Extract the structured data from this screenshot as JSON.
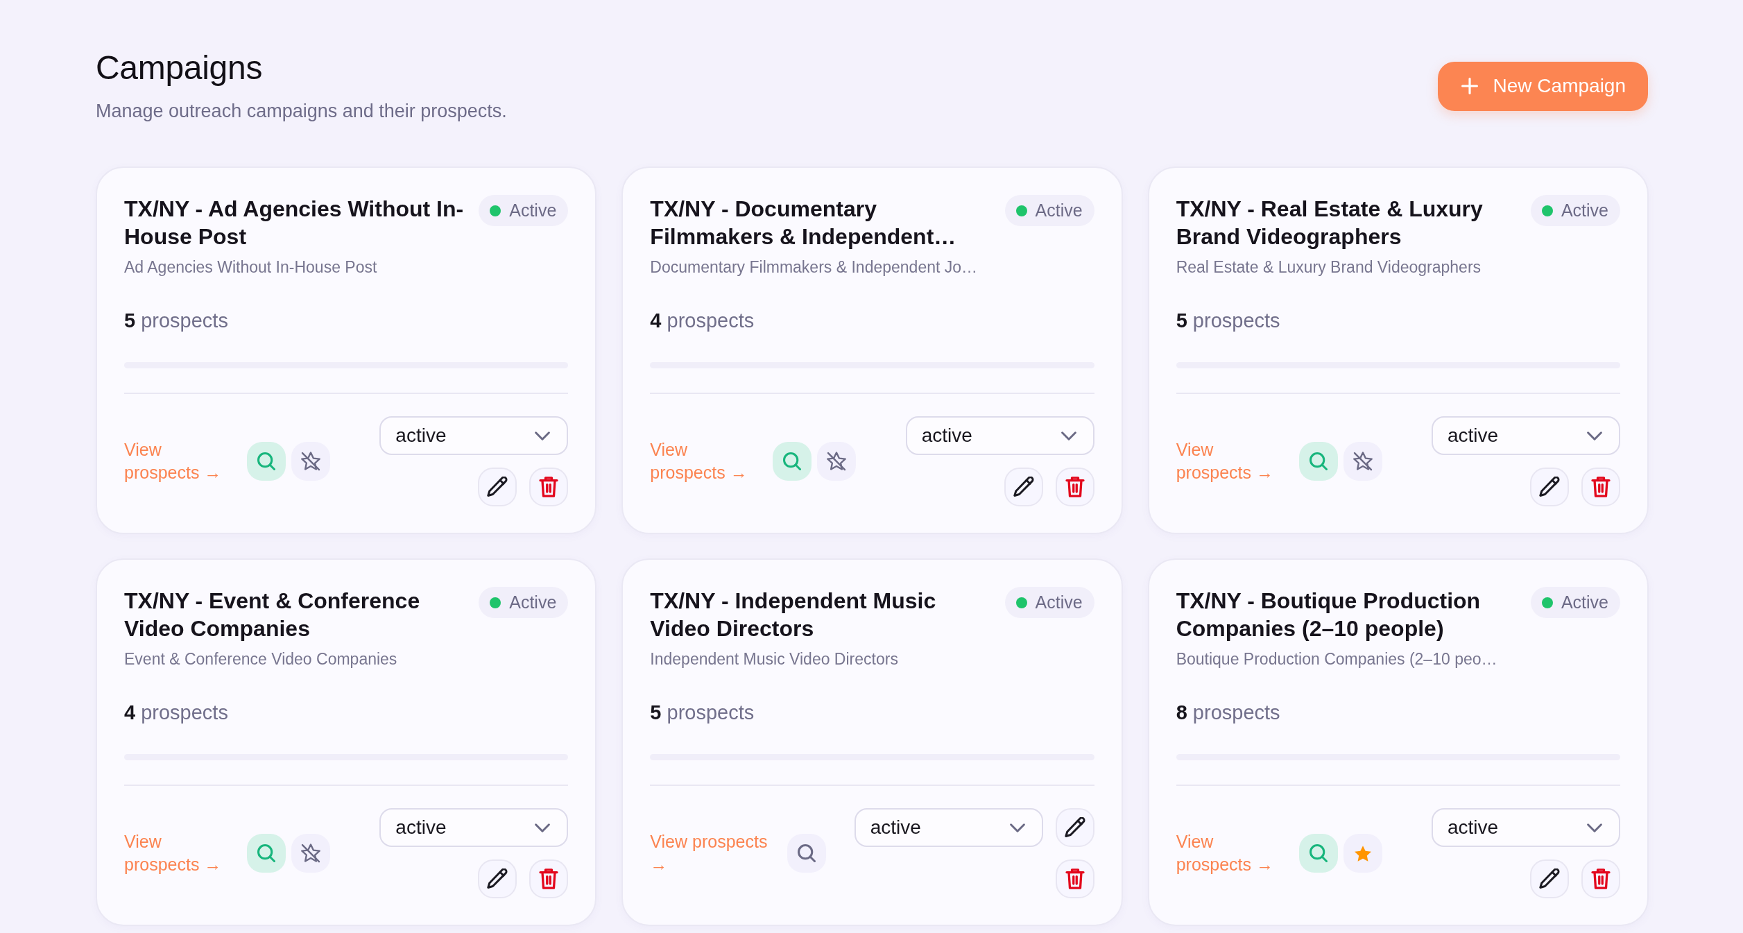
{
  "header": {
    "title": "Campaigns",
    "subtitle": "Manage outreach campaigns and their prospects.",
    "new_button": {
      "label": "New Campaign"
    }
  },
  "campaigns": [
    {
      "title": "TX/NY - Ad Agencies Without In-House Post",
      "status": "Active",
      "subtitle": "Ad Agencies Without In-House Post",
      "prospects": "**5** prospects",
      "link": "View prospects →",
      "search_highlighted": true,
      "starred": false,
      "dropdown": "active"
    },
    {
      "title": "TX/NY - Documentary Filmmakers & Independent…",
      "status": "Active",
      "subtitle": "Documentary Filmmakers & Independent Jo…",
      "prospects": "**4** prospects",
      "link": "View prospects →",
      "search_highlighted": true,
      "starred": false,
      "dropdown": "active"
    },
    {
      "title": "TX/NY - Real Estate & Luxury Brand Videographers",
      "status": "Active",
      "subtitle": "Real Estate & Luxury Brand Videographers",
      "prospects": "**5** prospects",
      "link": "View prospects →",
      "search_highlighted": true,
      "starred": false,
      "dropdown": "active"
    },
    {
      "title": "TX/NY - Event & Conference Video Companies",
      "status": "Active",
      "subtitle": "Event & Conference Video Companies",
      "prospects": "**4** prospects",
      "link": "View prospects →",
      "search_highlighted": true,
      "starred": false,
      "dropdown": "active"
    },
    {
      "title": "TX/NY - Independent Music Video Directors",
      "status": "Active",
      "subtitle": "Independent Music Video Directors",
      "prospects": "**5** prospects",
      "link": "View prospects →",
      "search_highlighted": false,
      "dropdown": "active"
    },
    {
      "title": "TX/NY - Boutique Production Companies (2–10 people)",
      "status": "Active",
      "subtitle": "Boutique Production Companies (2–10 peo…",
      "prospects": "**8** prospects",
      "link": "View prospects →",
      "search_highlighted": true,
      "starred": true,
      "dropdown": "active"
    }
  ]
}
